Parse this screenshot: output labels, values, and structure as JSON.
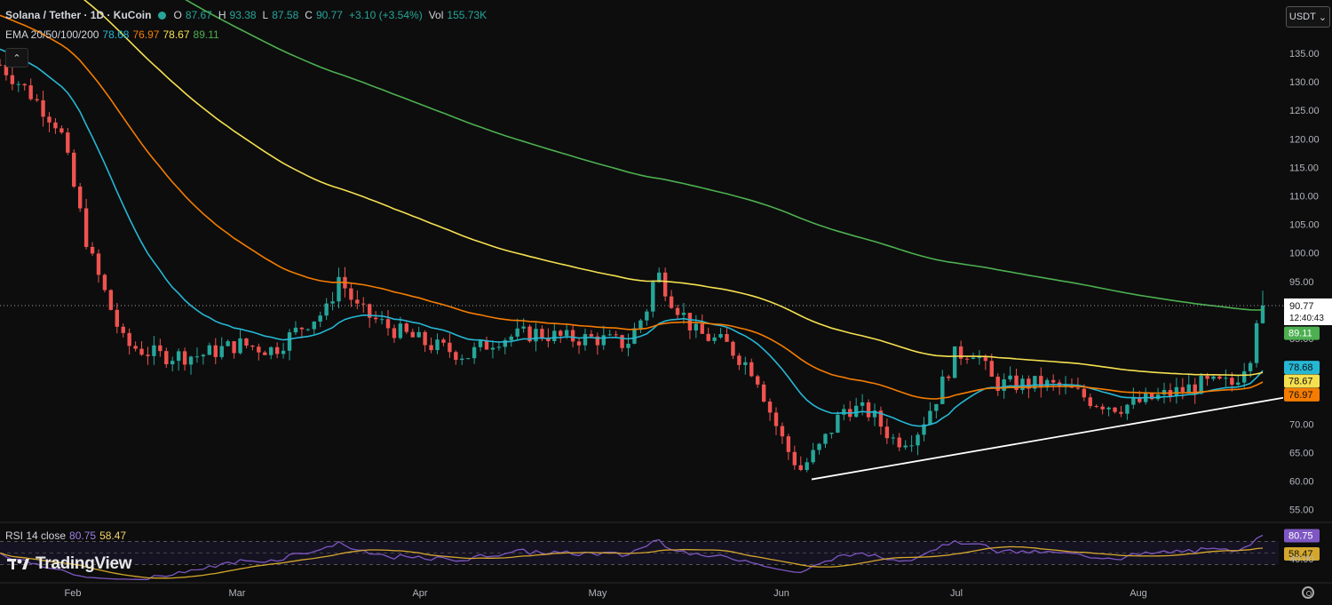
{
  "header": {
    "symbol": "Solana / Tether · 1D · KuCoin",
    "open_label": "O",
    "open": "87.67",
    "high_label": "H",
    "high": "93.38",
    "low_label": "L",
    "low": "87.58",
    "close_label": "C",
    "close": "90.77",
    "change": "+3.10 (+3.54%)",
    "volume_label": "Vol",
    "volume": "155.73K"
  },
  "ema": {
    "label": "EMA 20/50/100/200",
    "v20": "78.68",
    "v50": "76.97",
    "v100": "78.67",
    "v200": "89.11"
  },
  "rsi": {
    "label": "RSI 14 close",
    "value": "80.75",
    "ma": "58.47"
  },
  "currency": {
    "label": "USDT",
    "icon": "chevron-down-icon"
  },
  "logo": {
    "text": "TradingView"
  },
  "price_axis": {
    "ticks": [
      "135.00",
      "130.00",
      "125.00",
      "120.00",
      "115.00",
      "110.00",
      "105.00",
      "100.00",
      "95.00",
      "90.00",
      "85.00",
      "80.00",
      "75.00",
      "70.00",
      "65.00",
      "60.00",
      "55.00"
    ],
    "current_price": "90.77",
    "countdown": "12:40:43",
    "badges": [
      "89.11",
      "78.68",
      "78.67",
      "76.97"
    ]
  },
  "rsi_axis": {
    "badges": [
      "80.75",
      "58.47"
    ],
    "tick": "40.00"
  },
  "time_axis": {
    "labels": [
      "Feb",
      "Mar",
      "Apr",
      "May",
      "Jun",
      "Jul",
      "Aug"
    ]
  },
  "colors": {
    "up": "#26a69a",
    "down": "#ef5350",
    "ema20": "#26b7d4",
    "ema50": "#f57c00",
    "ema100": "#f5e050",
    "ema200": "#4caf50",
    "rsi": "#7e57c2",
    "rsi_ma": "#d4a72c",
    "trendline": "#ffffff"
  },
  "chart_data": {
    "type": "line",
    "title": "Solana / Tether · 1D · KuCoin",
    "ylim": [
      52,
      139
    ],
    "x": [
      "Feb",
      "Mar",
      "Apr",
      "May",
      "Jun",
      "Jul",
      "Aug"
    ],
    "series": [
      {
        "name": "EMA 20",
        "values": [
          120,
          85,
          82,
          86,
          73,
          79,
          78.68
        ]
      },
      {
        "name": "EMA 50",
        "values": [
          125,
          97,
          86,
          85,
          80,
          79,
          76.97
        ]
      },
      {
        "name": "EMA 100",
        "values": [
          138,
          106,
          97,
          94,
          88,
          80,
          78.67
        ]
      },
      {
        "name": "EMA 200",
        "values": [
          150,
          126,
          116,
          111,
          101,
          94,
          89.11
        ]
      }
    ],
    "last_close": 90.77,
    "rsi": {
      "value": 80.75,
      "ma": 58.47
    }
  }
}
